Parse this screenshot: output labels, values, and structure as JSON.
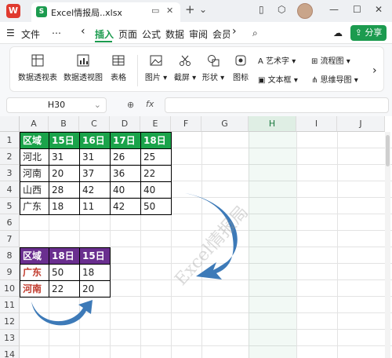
{
  "titlebar": {
    "logo": "W",
    "tab_icon": "S",
    "tab_title": "Excel情报局..xlsx",
    "new_tab": "+",
    "tab_menu": "⌄",
    "window_controls": [
      "—",
      "☐",
      "✕"
    ]
  },
  "menubar": {
    "file": "文件",
    "more": "⋯",
    "nav_left": "‹",
    "tabs": [
      "插入",
      "页面",
      "公式",
      "数据",
      "审阅",
      "会员"
    ],
    "nav_right": "›",
    "share": "分享"
  },
  "ribbon": {
    "pivot_table": "数据透视表",
    "pivot_chart": "数据透视图",
    "table": "表格",
    "picture": "图片",
    "screenshot": "截屏",
    "shapes": "形状",
    "icons": "图标",
    "wordart": "艺术字",
    "textbox": "文本框",
    "flowchart": "流程图",
    "mindmap": "思维导图"
  },
  "formula_bar": {
    "cell_ref": "H30",
    "fx": "fx",
    "zoom_icon": "⊕",
    "value": ""
  },
  "sheet": {
    "columns": [
      "A",
      "B",
      "C",
      "D",
      "E",
      "F",
      "G",
      "H",
      "I",
      "J"
    ],
    "active_column": "H",
    "rows": [
      "1",
      "2",
      "3",
      "4",
      "5",
      "6",
      "7",
      "8",
      "9",
      "10",
      "11",
      "12",
      "13",
      "14"
    ],
    "table1": {
      "header": [
        "区域",
        "15日",
        "16日",
        "17日",
        "18日"
      ],
      "rows": [
        [
          "河北",
          "31",
          "31",
          "26",
          "25"
        ],
        [
          "河南",
          "20",
          "37",
          "36",
          "22"
        ],
        [
          "山西",
          "28",
          "42",
          "40",
          "40"
        ],
        [
          "广东",
          "18",
          "11",
          "42",
          "50"
        ]
      ]
    },
    "table2": {
      "header": [
        "区域",
        "18日",
        "15日"
      ],
      "rows": [
        [
          "广东",
          "50",
          "18"
        ],
        [
          "河南",
          "22",
          "20"
        ]
      ]
    },
    "watermark": "Excel情报局"
  },
  "colors": {
    "accent": "#1c9b4f",
    "table1_header": "#1aa34a",
    "table2_header": "#6a2f8f",
    "highlight_text": "#c0392b",
    "arrow": "#3d7ab8"
  }
}
